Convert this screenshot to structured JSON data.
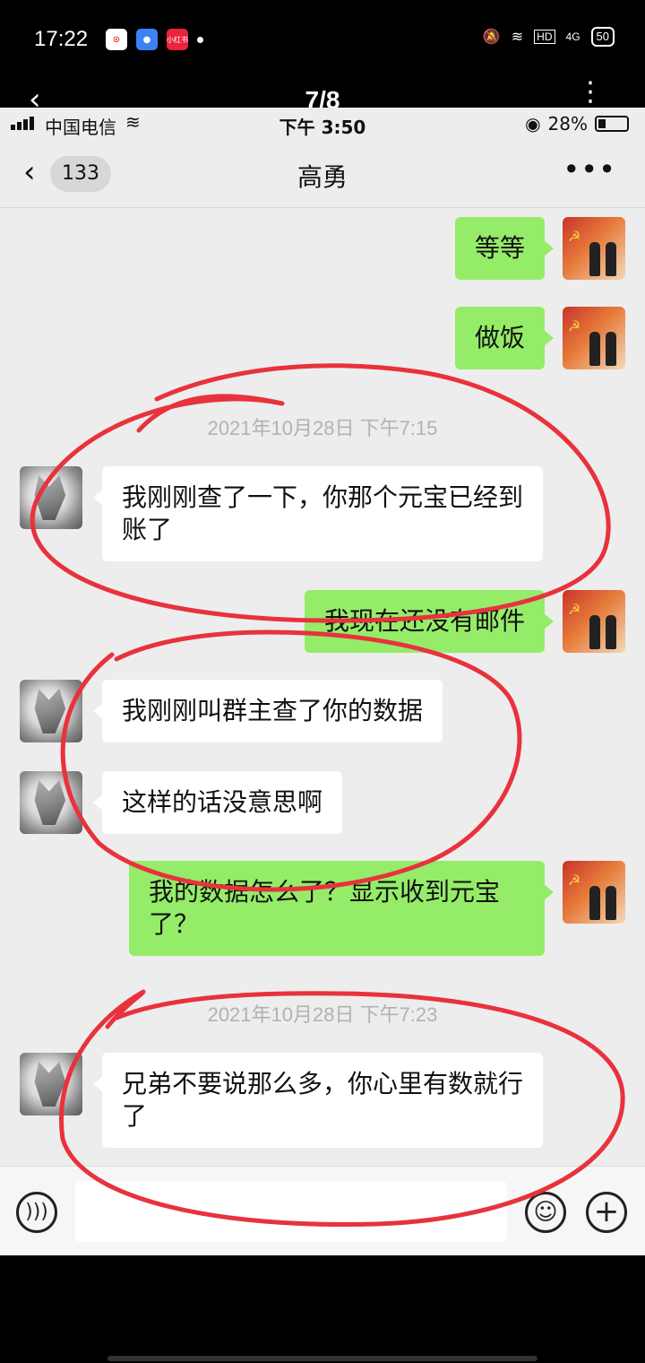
{
  "outer_status": {
    "time": "17:22",
    "app_badge_label": "小红书",
    "network": "4G",
    "battery": "50"
  },
  "viewer": {
    "back_glyph": "‹",
    "page_indicator": "7/8",
    "more_glyph": "⋮"
  },
  "inner_status": {
    "carrier": "中国电信",
    "time": "下午 3:50",
    "battery": "28%"
  },
  "chat_header": {
    "back_glyph": "‹",
    "unread_count": "133",
    "title": "高勇",
    "more_glyph": "•••"
  },
  "messages": [
    {
      "side": "self",
      "text": "等等"
    },
    {
      "side": "self",
      "text": "做饭"
    },
    {
      "type": "timestamp",
      "text": "2021年10月28日 下午7:15"
    },
    {
      "side": "other",
      "text": "我刚刚查了一下，你那个元宝已经到账了"
    },
    {
      "side": "self",
      "text": "我现在还没有邮件"
    },
    {
      "side": "other",
      "text": "我刚刚叫群主查了你的数据"
    },
    {
      "side": "other",
      "text": "这样的话没意思啊"
    },
    {
      "side": "self",
      "text": "我的数据怎么了？显示收到元宝了？"
    },
    {
      "type": "timestamp",
      "text": "2021年10月28日 下午7:23"
    },
    {
      "side": "other",
      "text": "兄弟不要说那么多，你心里有数就行了"
    }
  ],
  "input_bar": {
    "voice_icon": "voice-icon",
    "emoji_icon": "emoji-icon",
    "plus_icon": "plus-icon"
  },
  "colors": {
    "self_bubble": "#95ec69",
    "other_bubble": "#ffffff",
    "chat_background": "#ededed",
    "annotation_red": "#e8323c"
  }
}
